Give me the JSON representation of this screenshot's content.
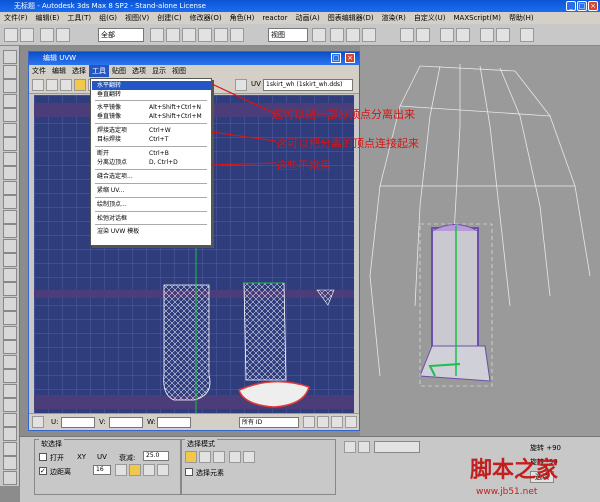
{
  "app": {
    "title": "无标题 - Autodesk 3ds Max 8 SP2 - Stand-alone License",
    "menus": [
      "文件(F)",
      "编辑(E)",
      "工具(T)",
      "组(G)",
      "视图(V)",
      "创建(C)",
      "修改器(O)",
      "角色(H)",
      "reactor",
      "动画(A)",
      "图表编辑器(D)",
      "渲染(R)",
      "自定义(U)",
      "MAXScript(M)",
      "帮助(H)"
    ],
    "toolbar_select": "全部",
    "view_select": "视图"
  },
  "uvw_window": {
    "title": "编辑 UVW",
    "menus": [
      "文件",
      "编辑",
      "选择",
      "工具",
      "贴图",
      "选项",
      "显示",
      "视图"
    ],
    "active_menu": "工具",
    "uv_label": "UV",
    "texture_select": "1skirt_wh (1skirt_wh.dds)",
    "status": {
      "u_label": "U:",
      "v_label": "V:",
      "w_label": "W:",
      "filter_select": "所有 ID"
    }
  },
  "tools_menu": {
    "items": [
      {
        "label": "水平翻转",
        "shortcut": "",
        "highlight": true
      },
      {
        "label": "垂直翻转",
        "shortcut": ""
      },
      {
        "label": "水平镜像",
        "shortcut": "Alt+Shift+Ctrl+N"
      },
      {
        "label": "垂直镜像",
        "shortcut": "Alt+Shift+Ctrl+M"
      },
      {
        "label": "焊接选定项",
        "shortcut": "Ctrl+W"
      },
      {
        "label": "目标焊接",
        "shortcut": "Ctrl+T"
      },
      {
        "label": "断开",
        "shortcut": "Ctrl+B"
      },
      {
        "label": "分离边顶点",
        "shortcut": "D, Ctrl+D"
      },
      {
        "label": "缝合选定项...",
        "shortcut": ""
      },
      {
        "label": "紧缩 UV...",
        "shortcut": ""
      },
      {
        "label": "绘制顶点...",
        "shortcut": ""
      },
      {
        "label": "松弛对话框",
        "shortcut": ""
      },
      {
        "label": "渲染 UVW 模板",
        "shortcut": ""
      }
    ]
  },
  "annotations": [
    "这可以把一部分顶点分离出来",
    "这可以把分离的顶点连接起来",
    "这些不常用"
  ],
  "bottom_panel": {
    "soft_select_label": "软选择",
    "open_label": "打开",
    "xy_label": "XY",
    "uv_label": "UV",
    "falloff_label": "衰减:",
    "falloff_value": "25.0",
    "edge_distance_label": "边距离",
    "edge_distance_value": "16",
    "select_mode_label": "选择模式",
    "select_elements_label": "选择元素",
    "rotate_plus": "旋转 +90",
    "rotate_minus": "旋转 -90",
    "options_label": "选项"
  },
  "watermark": {
    "text": "脚本之家",
    "url": "www.jb51.net"
  },
  "colors": {
    "accent": "#2456c4",
    "annotation": "#d81414",
    "uv_bg": "#2f3d7c"
  }
}
